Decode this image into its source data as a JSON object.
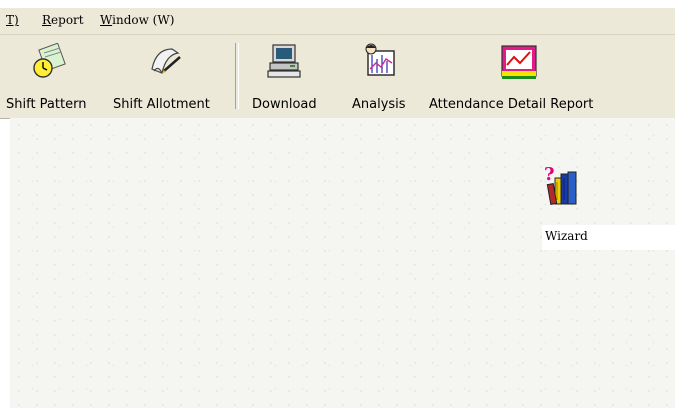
{
  "menubar": {
    "items": [
      {
        "label": "T)",
        "icon": ""
      },
      {
        "label": "Report"
      },
      {
        "label": "Window (W)"
      }
    ]
  },
  "toolbar": {
    "buttons": [
      {
        "label": "Shift Pattern",
        "icon": "calendar-clock-icon"
      },
      {
        "label": "Shift Allotment",
        "icon": "scroll-pen-icon"
      },
      {
        "label": "Download",
        "icon": "computer-terminal-icon"
      },
      {
        "label": "Analysis",
        "icon": "chart-person-icon"
      },
      {
        "label": "Attendance Detail Report",
        "icon": "line-chart-report-icon"
      }
    ]
  },
  "workspace": {
    "shortcuts": [
      {
        "label": "Wizard",
        "icon": "books-question-icon"
      }
    ]
  }
}
